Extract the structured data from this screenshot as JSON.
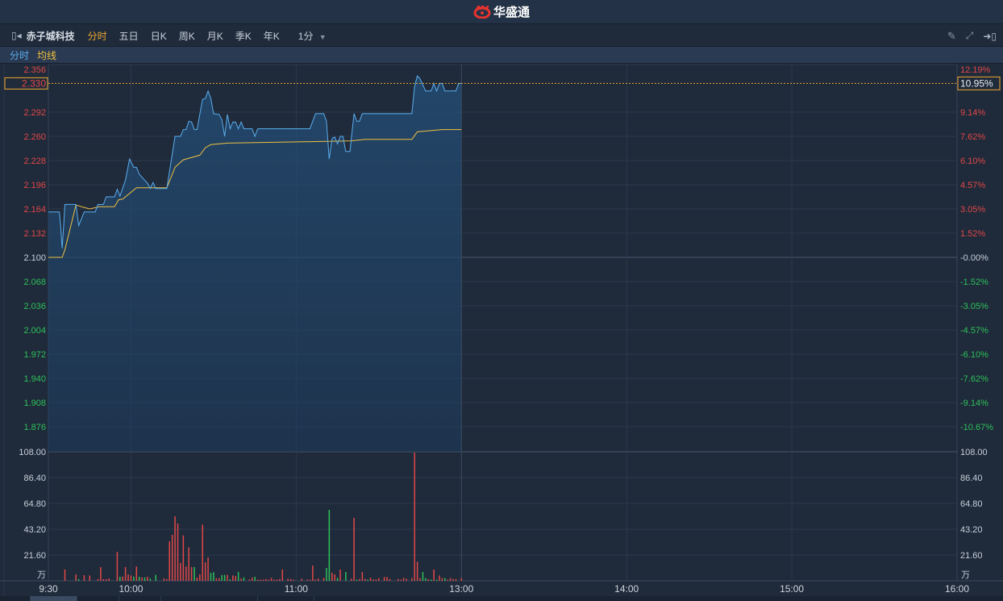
{
  "header": {
    "brand": "华盛通"
  },
  "toolbar": {
    "stock_name": "赤子城科技",
    "tabs": [
      "分时",
      "五日",
      "日K",
      "周K",
      "月K",
      "季K",
      "年K"
    ],
    "active_tab": "分时",
    "interval": "1分"
  },
  "legend": {
    "price_line": "分时",
    "avg_line": "均线"
  },
  "colors": {
    "price_line": "#5aaef0",
    "avg_line": "#f0c040",
    "up": "#e04848",
    "down": "#2ec05a",
    "accent": "#f0a830"
  },
  "current": {
    "price_label": "2.330",
    "percent_label": "10.95%",
    "price": 2.33
  },
  "chart_data": {
    "type": "line",
    "prev_close": 2.1,
    "x_ticks": [
      {
        "label": "9:30",
        "min": 0
      },
      {
        "label": "10:00",
        "min": 30
      },
      {
        "label": "11:00",
        "min": 90
      },
      {
        "label": "13:00",
        "min": 150
      },
      {
        "label": "14:00",
        "min": 210
      },
      {
        "label": "15:00",
        "min": 270
      },
      {
        "label": "16:00",
        "min": 330
      }
    ],
    "x_range_minutes": [
      0,
      330
    ],
    "y_range": [
      1.876,
      2.356
    ],
    "price_ticks": [
      {
        "price": 2.292,
        "label": "2.292",
        "pct": "9.14%"
      },
      {
        "price": 2.26,
        "label": "2.260",
        "pct": "7.62%"
      },
      {
        "price": 2.228,
        "label": "2.228",
        "pct": "6.10%"
      },
      {
        "price": 2.196,
        "label": "2.196",
        "pct": "4.57%"
      },
      {
        "price": 2.164,
        "label": "2.164",
        "pct": "3.05%"
      },
      {
        "price": 2.132,
        "label": "2.132",
        "pct": "1.52%"
      },
      {
        "price": 2.1,
        "label": "2.100",
        "pct": "-0.00%"
      },
      {
        "price": 2.068,
        "label": "2.068",
        "pct": "-1.52%"
      },
      {
        "price": 2.036,
        "label": "2.036",
        "pct": "-3.05%"
      },
      {
        "price": 2.004,
        "label": "2.004",
        "pct": "-4.57%"
      },
      {
        "price": 1.972,
        "label": "1.972",
        "pct": "-6.10%"
      },
      {
        "price": 1.94,
        "label": "1.940",
        "pct": "-7.62%"
      },
      {
        "price": 1.908,
        "label": "1.908",
        "pct": "-9.14%"
      },
      {
        "price": 1.876,
        "label": "1.876",
        "pct": "-10.67%"
      }
    ],
    "top_tick": {
      "label": "2.356",
      "pct": "12.19%"
    },
    "price_series": [
      [
        0,
        2.16
      ],
      [
        4,
        2.16
      ],
      [
        4.5,
        2.139
      ],
      [
        5,
        2.112
      ],
      [
        5.5,
        2.139
      ],
      [
        6,
        2.17
      ],
      [
        10,
        2.17
      ],
      [
        11,
        2.142
      ],
      [
        13,
        2.16
      ],
      [
        17,
        2.16
      ],
      [
        18,
        2.17
      ],
      [
        20,
        2.17
      ],
      [
        21,
        2.18
      ],
      [
        24,
        2.18
      ],
      [
        25,
        2.19
      ],
      [
        26,
        2.181
      ],
      [
        28,
        2.202
      ],
      [
        29.5,
        2.23
      ],
      [
        31,
        2.219
      ],
      [
        32,
        2.219
      ],
      [
        33,
        2.21
      ],
      [
        35,
        2.202
      ],
      [
        36,
        2.198
      ],
      [
        37,
        2.191
      ],
      [
        38,
        2.199
      ],
      [
        39,
        2.191
      ],
      [
        43,
        2.191
      ],
      [
        46,
        2.26
      ],
      [
        48,
        2.26
      ],
      [
        49,
        2.269
      ],
      [
        50,
        2.269
      ],
      [
        51,
        2.28
      ],
      [
        52,
        2.279
      ],
      [
        53,
        2.269
      ],
      [
        54,
        2.269
      ],
      [
        56,
        2.309
      ],
      [
        57,
        2.31
      ],
      [
        58,
        2.32
      ],
      [
        59,
        2.31
      ],
      [
        60,
        2.29
      ],
      [
        62,
        2.289
      ],
      [
        63,
        2.282
      ],
      [
        64,
        2.26
      ],
      [
        65,
        2.289
      ],
      [
        66,
        2.27
      ],
      [
        67,
        2.279
      ],
      [
        68,
        2.279
      ],
      [
        69,
        2.27
      ],
      [
        70,
        2.279
      ],
      [
        71,
        2.27
      ],
      [
        74,
        2.27
      ],
      [
        75,
        2.26
      ],
      [
        76,
        2.27
      ],
      [
        95,
        2.27
      ],
      [
        97,
        2.29
      ],
      [
        100,
        2.29
      ],
      [
        101,
        2.28
      ],
      [
        102,
        2.23
      ],
      [
        103,
        2.257
      ],
      [
        104,
        2.259
      ],
      [
        105,
        2.25
      ],
      [
        106,
        2.26
      ],
      [
        107,
        2.26
      ],
      [
        108,
        2.24
      ],
      [
        109.5,
        2.24
      ],
      [
        111,
        2.29
      ],
      [
        112,
        2.28
      ],
      [
        113,
        2.28
      ],
      [
        114,
        2.29
      ],
      [
        132,
        2.29
      ],
      [
        133,
        2.326
      ],
      [
        134,
        2.34
      ],
      [
        135,
        2.336
      ],
      [
        137,
        2.32
      ],
      [
        139,
        2.32
      ],
      [
        140,
        2.33
      ],
      [
        141,
        2.32
      ],
      [
        142,
        2.33
      ],
      [
        143,
        2.33
      ],
      [
        144,
        2.32
      ],
      [
        148,
        2.32
      ],
      [
        149,
        2.33
      ],
      [
        150,
        2.33
      ]
    ],
    "avg_series": [
      [
        0,
        2.1
      ],
      [
        5,
        2.1
      ],
      [
        6,
        2.11
      ],
      [
        10,
        2.169
      ],
      [
        15,
        2.164
      ],
      [
        18.5,
        2.167
      ],
      [
        24,
        2.167
      ],
      [
        25.5,
        2.176
      ],
      [
        27,
        2.177
      ],
      [
        32,
        2.192
      ],
      [
        43,
        2.192
      ],
      [
        46,
        2.219
      ],
      [
        49,
        2.229
      ],
      [
        55,
        2.235
      ],
      [
        57,
        2.245
      ],
      [
        59,
        2.249
      ],
      [
        65,
        2.251
      ],
      [
        95,
        2.253
      ],
      [
        110,
        2.254
      ],
      [
        115,
        2.256
      ],
      [
        132,
        2.256
      ],
      [
        134,
        2.266
      ],
      [
        143,
        2.269
      ],
      [
        150,
        2.269
      ]
    ],
    "volume": {
      "unit": "万",
      "max": 108,
      "ticks": [
        "108.00",
        "86.40",
        "64.80",
        "43.20",
        "21.60"
      ],
      "tick_values": [
        108,
        86.4,
        64.8,
        43.2,
        21.6
      ],
      "bars": [
        [
          6,
          9.5,
          "u"
        ],
        [
          10,
          5.4,
          "u"
        ],
        [
          11,
          1.4,
          "d"
        ],
        [
          13,
          4.7,
          "u"
        ],
        [
          15,
          4.5,
          "u"
        ],
        [
          18,
          1.5,
          "u"
        ],
        [
          19,
          11.5,
          "u"
        ],
        [
          20,
          1.4,
          "u"
        ],
        [
          21,
          1.4,
          "u"
        ],
        [
          22,
          2,
          "u"
        ],
        [
          25,
          24.3,
          "u"
        ],
        [
          26,
          3.4,
          "d"
        ],
        [
          27,
          3.6,
          "u"
        ],
        [
          28,
          11.5,
          "u"
        ],
        [
          29,
          5.4,
          "u"
        ],
        [
          30,
          4.5,
          "u"
        ],
        [
          31,
          3.6,
          "d"
        ],
        [
          32,
          12,
          "u"
        ],
        [
          33,
          3.4,
          "d"
        ],
        [
          34,
          2.9,
          "u"
        ],
        [
          35,
          2.9,
          "d"
        ],
        [
          36,
          3.4,
          "u"
        ],
        [
          37,
          2,
          "d"
        ],
        [
          39,
          5,
          "d"
        ],
        [
          42,
          2.1,
          "u"
        ],
        [
          43,
          1.5,
          "u"
        ],
        [
          44,
          33,
          "u"
        ],
        [
          45,
          38.5,
          "u"
        ],
        [
          46,
          54,
          "u"
        ],
        [
          47,
          48,
          "u"
        ],
        [
          48,
          15,
          "u"
        ],
        [
          49,
          38,
          "u"
        ],
        [
          50,
          12,
          "u"
        ],
        [
          51,
          28,
          "u"
        ],
        [
          52,
          11.5,
          "u"
        ],
        [
          53,
          11.5,
          "d"
        ],
        [
          54,
          2.7,
          "u"
        ],
        [
          55,
          5.4,
          "u"
        ],
        [
          56,
          47,
          "u"
        ],
        [
          57,
          15.5,
          "u"
        ],
        [
          58,
          19.6,
          "u"
        ],
        [
          59,
          6.6,
          "d"
        ],
        [
          60,
          7.2,
          "d"
        ],
        [
          61,
          2.2,
          "u"
        ],
        [
          62,
          2.2,
          "u"
        ],
        [
          63,
          4.8,
          "d"
        ],
        [
          64,
          5,
          "d"
        ],
        [
          65,
          5,
          "u"
        ],
        [
          66,
          1.2,
          "d"
        ],
        [
          67,
          4.5,
          "u"
        ],
        [
          68,
          4,
          "u"
        ],
        [
          69,
          7.4,
          "d"
        ],
        [
          70,
          2,
          "u"
        ],
        [
          71,
          2.9,
          "d"
        ],
        [
          73,
          1.2,
          "u"
        ],
        [
          74,
          2.7,
          "u"
        ],
        [
          75,
          3.4,
          "d"
        ],
        [
          76,
          1,
          "u"
        ],
        [
          77,
          1,
          "u"
        ],
        [
          78,
          1,
          "u"
        ],
        [
          79,
          1.5,
          "u"
        ],
        [
          80,
          1,
          "u"
        ],
        [
          81,
          2.5,
          "u"
        ],
        [
          82,
          1,
          "u"
        ],
        [
          83,
          1,
          "u"
        ],
        [
          84,
          1.6,
          "u"
        ],
        [
          85,
          9.5,
          "u"
        ],
        [
          87,
          1.8,
          "u"
        ],
        [
          88,
          1.5,
          "u"
        ],
        [
          89,
          1,
          "u"
        ],
        [
          92,
          1.8,
          "u"
        ],
        [
          94,
          1,
          "u"
        ],
        [
          95,
          1,
          "u"
        ],
        [
          96,
          12.8,
          "u"
        ],
        [
          97,
          1,
          "u"
        ],
        [
          98,
          2,
          "u"
        ],
        [
          100,
          2.5,
          "u"
        ],
        [
          101,
          10.8,
          "d"
        ],
        [
          102,
          59.4,
          "d"
        ],
        [
          103,
          6.8,
          "u"
        ],
        [
          104,
          5.4,
          "u"
        ],
        [
          105,
          2.5,
          "d"
        ],
        [
          106,
          9.5,
          "u"
        ],
        [
          108,
          7.4,
          "d"
        ],
        [
          110,
          1.8,
          "u"
        ],
        [
          111,
          52.6,
          "u"
        ],
        [
          112,
          1,
          "d"
        ],
        [
          113,
          1.5,
          "u"
        ],
        [
          114,
          7.4,
          "u"
        ],
        [
          115,
          1.8,
          "u"
        ],
        [
          116,
          1,
          "d"
        ],
        [
          117,
          2.7,
          "u"
        ],
        [
          118,
          1.2,
          "u"
        ],
        [
          119,
          1.2,
          "u"
        ],
        [
          120,
          2.3,
          "u"
        ],
        [
          122,
          3.2,
          "u"
        ],
        [
          123,
          3.2,
          "u"
        ],
        [
          124,
          1.6,
          "u"
        ],
        [
          127,
          1.6,
          "u"
        ],
        [
          128,
          1,
          "u"
        ],
        [
          129,
          2.5,
          "u"
        ],
        [
          130,
          1.8,
          "u"
        ],
        [
          132,
          2.3,
          "u"
        ],
        [
          133,
          107.3,
          "u"
        ],
        [
          134,
          16,
          "u"
        ],
        [
          135,
          2.3,
          "u"
        ],
        [
          136,
          7.4,
          "d"
        ],
        [
          137,
          2.3,
          "d"
        ],
        [
          138,
          1.5,
          "u"
        ],
        [
          139,
          1,
          "d"
        ],
        [
          140,
          9.5,
          "u"
        ],
        [
          141,
          1,
          "d"
        ],
        [
          142,
          4.5,
          "u"
        ],
        [
          143,
          2.3,
          "u"
        ],
        [
          144,
          2.3,
          "d"
        ],
        [
          145,
          1,
          "u"
        ],
        [
          146,
          2.3,
          "u"
        ],
        [
          147,
          1.5,
          "u"
        ],
        [
          148,
          1.5,
          "u"
        ],
        [
          150,
          2.3,
          "u"
        ]
      ]
    }
  }
}
